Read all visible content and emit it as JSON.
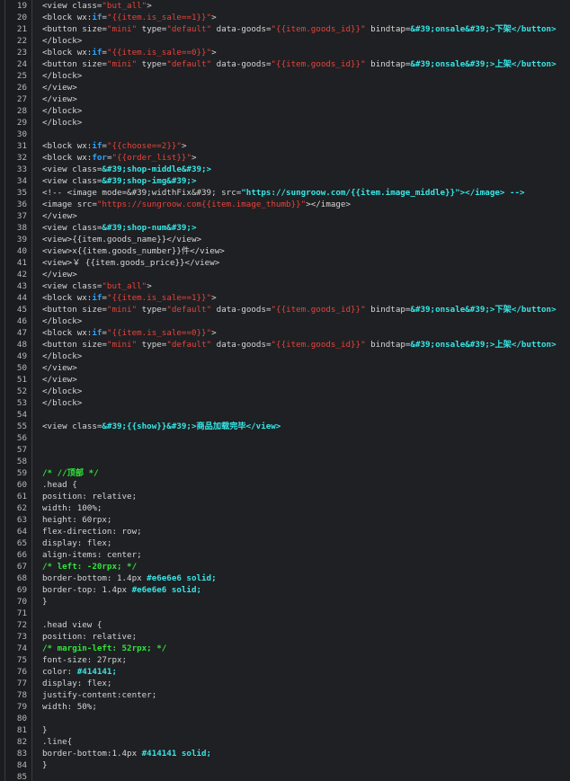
{
  "colors": {
    "background": "#1f2023",
    "gutter": "#1b1c1f",
    "line_number": "#b8b8b8",
    "text": "#d6d6d6",
    "string": "#e8433a",
    "keyword": "#2ea3ff",
    "entity": "#36e6e6",
    "comment": "#2ee63a"
  },
  "lines": [
    {
      "n": "19",
      "tokens": [
        {
          "t": "text",
          "v": "<view class="
        },
        {
          "t": "str",
          "v": "\"but_all\""
        },
        {
          "t": "text",
          "v": ">"
        }
      ]
    },
    {
      "n": "20",
      "tokens": [
        {
          "t": "text",
          "v": "<block wx:"
        },
        {
          "t": "kw",
          "v": "if"
        },
        {
          "t": "text",
          "v": "="
        },
        {
          "t": "str",
          "v": "\"{{item.is_sale==1}}\""
        },
        {
          "t": "text",
          "v": ">"
        }
      ]
    },
    {
      "n": "21",
      "tokens": [
        {
          "t": "text",
          "v": "<button size="
        },
        {
          "t": "str",
          "v": "\"mini\""
        },
        {
          "t": "text",
          "v": " type="
        },
        {
          "t": "str",
          "v": "\"default\""
        },
        {
          "t": "text",
          "v": " data-goods="
        },
        {
          "t": "str",
          "v": "\"{{item.goods_id}}\""
        },
        {
          "t": "text",
          "v": " bindtap="
        },
        {
          "t": "bold",
          "v": "&#39;onsale&#39;>下架</button>"
        }
      ]
    },
    {
      "n": "22",
      "tokens": [
        {
          "t": "text",
          "v": "</block>"
        }
      ]
    },
    {
      "n": "23",
      "tokens": [
        {
          "t": "text",
          "v": "<block wx:"
        },
        {
          "t": "kw",
          "v": "if"
        },
        {
          "t": "text",
          "v": "="
        },
        {
          "t": "str",
          "v": "\"{{item.is_sale==0}}\""
        },
        {
          "t": "text",
          "v": ">"
        }
      ]
    },
    {
      "n": "24",
      "tokens": [
        {
          "t": "text",
          "v": "<button size="
        },
        {
          "t": "str",
          "v": "\"mini\""
        },
        {
          "t": "text",
          "v": " type="
        },
        {
          "t": "str",
          "v": "\"default\""
        },
        {
          "t": "text",
          "v": " data-goods="
        },
        {
          "t": "str",
          "v": "\"{{item.goods_id}}\""
        },
        {
          "t": "text",
          "v": " bindtap="
        },
        {
          "t": "bold",
          "v": "&#39;onsale&#39;>上架</button>"
        }
      ]
    },
    {
      "n": "25",
      "tokens": [
        {
          "t": "text",
          "v": "</block>"
        }
      ]
    },
    {
      "n": "26",
      "tokens": [
        {
          "t": "text",
          "v": "</view>"
        }
      ]
    },
    {
      "n": "27",
      "tokens": [
        {
          "t": "text",
          "v": "</view>"
        }
      ]
    },
    {
      "n": "28",
      "tokens": [
        {
          "t": "text",
          "v": "</block>"
        }
      ]
    },
    {
      "n": "29",
      "tokens": [
        {
          "t": "text",
          "v": "</block>"
        }
      ]
    },
    {
      "n": "30",
      "tokens": []
    },
    {
      "n": "31",
      "tokens": [
        {
          "t": "text",
          "v": "<block wx:"
        },
        {
          "t": "kw",
          "v": "if"
        },
        {
          "t": "text",
          "v": "="
        },
        {
          "t": "str",
          "v": "\"{{choose==2}}\""
        },
        {
          "t": "text",
          "v": ">"
        }
      ]
    },
    {
      "n": "32",
      "tokens": [
        {
          "t": "text",
          "v": "<block wx:"
        },
        {
          "t": "kw",
          "v": "for"
        },
        {
          "t": "text",
          "v": "="
        },
        {
          "t": "str",
          "v": "\"{{order_list}}\""
        },
        {
          "t": "text",
          "v": ">"
        }
      ]
    },
    {
      "n": "33",
      "tokens": [
        {
          "t": "text",
          "v": "<view class="
        },
        {
          "t": "bold",
          "v": "&#39;shop-middle&#39;>"
        }
      ]
    },
    {
      "n": "34",
      "tokens": [
        {
          "t": "text",
          "v": "<view class="
        },
        {
          "t": "bold",
          "v": "&#39;shop-img&#39;>"
        }
      ]
    },
    {
      "n": "35",
      "tokens": [
        {
          "t": "text",
          "v": "<!-- <image mode=&#39;widthFix&#39; src="
        },
        {
          "t": "bold",
          "v": "\"https://sungroow.com/{{item.image_middle}}\"></image> -->"
        }
      ]
    },
    {
      "n": "36",
      "tokens": [
        {
          "t": "text",
          "v": "<image src="
        },
        {
          "t": "str",
          "v": "\"https://sungroow.com{{item.image_thumb}}\""
        },
        {
          "t": "text",
          "v": "></image>"
        }
      ]
    },
    {
      "n": "37",
      "tokens": [
        {
          "t": "text",
          "v": "</view>"
        }
      ]
    },
    {
      "n": "38",
      "tokens": [
        {
          "t": "text",
          "v": "<view class="
        },
        {
          "t": "bold",
          "v": "&#39;shop-num&#39;>"
        }
      ]
    },
    {
      "n": "39",
      "tokens": [
        {
          "t": "text",
          "v": "<view>{{item.goods_name}}</view>"
        }
      ]
    },
    {
      "n": "40",
      "tokens": [
        {
          "t": "text",
          "v": "<view>x{{item.goods_number}}件</view>"
        }
      ]
    },
    {
      "n": "41",
      "tokens": [
        {
          "t": "text",
          "v": "<view>￥ {{item.goods_price}}</view>"
        }
      ]
    },
    {
      "n": "42",
      "tokens": [
        {
          "t": "text",
          "v": "</view>"
        }
      ]
    },
    {
      "n": "43",
      "tokens": [
        {
          "t": "text",
          "v": "<view class="
        },
        {
          "t": "str",
          "v": "\"but_all\""
        },
        {
          "t": "text",
          "v": ">"
        }
      ]
    },
    {
      "n": "44",
      "tokens": [
        {
          "t": "text",
          "v": "<block wx:"
        },
        {
          "t": "kw",
          "v": "if"
        },
        {
          "t": "text",
          "v": "="
        },
        {
          "t": "str",
          "v": "\"{{item.is_sale==1}}\""
        },
        {
          "t": "text",
          "v": ">"
        }
      ]
    },
    {
      "n": "45",
      "tokens": [
        {
          "t": "text",
          "v": "<button size="
        },
        {
          "t": "str",
          "v": "\"mini\""
        },
        {
          "t": "text",
          "v": " type="
        },
        {
          "t": "str",
          "v": "\"default\""
        },
        {
          "t": "text",
          "v": " data-goods="
        },
        {
          "t": "str",
          "v": "\"{{item.goods_id}}\""
        },
        {
          "t": "text",
          "v": " bindtap="
        },
        {
          "t": "bold",
          "v": "&#39;onsale&#39;>下架</button>"
        }
      ]
    },
    {
      "n": "46",
      "tokens": [
        {
          "t": "text",
          "v": "</block>"
        }
      ]
    },
    {
      "n": "47",
      "tokens": [
        {
          "t": "text",
          "v": "<block wx:"
        },
        {
          "t": "kw",
          "v": "if"
        },
        {
          "t": "text",
          "v": "="
        },
        {
          "t": "str",
          "v": "\"{{item.is_sale==0}}\""
        },
        {
          "t": "text",
          "v": ">"
        }
      ]
    },
    {
      "n": "48",
      "tokens": [
        {
          "t": "text",
          "v": "<button size="
        },
        {
          "t": "str",
          "v": "\"mini\""
        },
        {
          "t": "text",
          "v": " type="
        },
        {
          "t": "str",
          "v": "\"default\""
        },
        {
          "t": "text",
          "v": " data-goods="
        },
        {
          "t": "str",
          "v": "\"{{item.goods_id}}\""
        },
        {
          "t": "text",
          "v": " bindtap="
        },
        {
          "t": "bold",
          "v": "&#39;onsale&#39;>上架</button>"
        }
      ]
    },
    {
      "n": "49",
      "tokens": [
        {
          "t": "text",
          "v": "</block>"
        }
      ]
    },
    {
      "n": "50",
      "tokens": [
        {
          "t": "text",
          "v": "</view>"
        }
      ]
    },
    {
      "n": "51",
      "tokens": [
        {
          "t": "text",
          "v": "</view>"
        }
      ]
    },
    {
      "n": "52",
      "tokens": [
        {
          "t": "text",
          "v": "</block>"
        }
      ]
    },
    {
      "n": "53",
      "tokens": [
        {
          "t": "text",
          "v": "</block>"
        }
      ]
    },
    {
      "n": "54",
      "tokens": []
    },
    {
      "n": "55",
      "tokens": [
        {
          "t": "text",
          "v": "<view class="
        },
        {
          "t": "bold",
          "v": "&#39;{{show}}&#39;>商品加载完毕</view>"
        }
      ]
    },
    {
      "n": "56",
      "tokens": []
    },
    {
      "n": "57",
      "tokens": []
    },
    {
      "n": "58",
      "tokens": []
    },
    {
      "n": "59",
      "tokens": [
        {
          "t": "comment",
          "v": "/* //顶部 */"
        }
      ]
    },
    {
      "n": "60",
      "tokens": [
        {
          "t": "text",
          "v": ".head {"
        }
      ]
    },
    {
      "n": "61",
      "tokens": [
        {
          "t": "text",
          "v": "position: relative;"
        }
      ]
    },
    {
      "n": "62",
      "tokens": [
        {
          "t": "text",
          "v": "width: 100%;"
        }
      ]
    },
    {
      "n": "63",
      "tokens": [
        {
          "t": "text",
          "v": "height: 60rpx;"
        }
      ]
    },
    {
      "n": "64",
      "tokens": [
        {
          "t": "text",
          "v": "flex-direction: row;"
        }
      ]
    },
    {
      "n": "65",
      "tokens": [
        {
          "t": "text",
          "v": "display: flex;"
        }
      ]
    },
    {
      "n": "66",
      "tokens": [
        {
          "t": "text",
          "v": "align-items: center;"
        }
      ]
    },
    {
      "n": "67",
      "tokens": [
        {
          "t": "comment",
          "v": "/* left: -20rpx; */"
        }
      ]
    },
    {
      "n": "68",
      "tokens": [
        {
          "t": "text",
          "v": "border-bottom: 1.4px "
        },
        {
          "t": "bold",
          "v": "#e6e6e6 solid;"
        }
      ]
    },
    {
      "n": "69",
      "tokens": [
        {
          "t": "text",
          "v": "border-top: 1.4px "
        },
        {
          "t": "bold",
          "v": "#e6e6e6 solid;"
        }
      ]
    },
    {
      "n": "70",
      "tokens": [
        {
          "t": "text",
          "v": "}"
        }
      ]
    },
    {
      "n": "71",
      "tokens": []
    },
    {
      "n": "72",
      "tokens": [
        {
          "t": "text",
          "v": ".head view {"
        }
      ]
    },
    {
      "n": "73",
      "tokens": [
        {
          "t": "text",
          "v": "position: relative;"
        }
      ]
    },
    {
      "n": "74",
      "tokens": [
        {
          "t": "comment",
          "v": "/* margin-left: 52rpx; */"
        }
      ]
    },
    {
      "n": "75",
      "tokens": [
        {
          "t": "text",
          "v": "font-size: 27rpx;"
        }
      ]
    },
    {
      "n": "76",
      "tokens": [
        {
          "t": "text",
          "v": "color: "
        },
        {
          "t": "bold",
          "v": "#414141;"
        }
      ]
    },
    {
      "n": "77",
      "tokens": [
        {
          "t": "text",
          "v": "display: flex;"
        }
      ]
    },
    {
      "n": "78",
      "tokens": [
        {
          "t": "text",
          "v": "justify-content:center;"
        }
      ]
    },
    {
      "n": "79",
      "tokens": [
        {
          "t": "text",
          "v": "width: 50%;"
        }
      ]
    },
    {
      "n": "80",
      "tokens": []
    },
    {
      "n": "81",
      "tokens": [
        {
          "t": "text",
          "v": "}"
        }
      ]
    },
    {
      "n": "82",
      "tokens": [
        {
          "t": "text",
          "v": ".line{"
        }
      ]
    },
    {
      "n": "83",
      "tokens": [
        {
          "t": "text",
          "v": "border-bottom:1.4px "
        },
        {
          "t": "bold",
          "v": "#414141 solid;"
        }
      ]
    },
    {
      "n": "84",
      "tokens": [
        {
          "t": "text",
          "v": "}"
        }
      ]
    },
    {
      "n": "85",
      "tokens": []
    }
  ]
}
